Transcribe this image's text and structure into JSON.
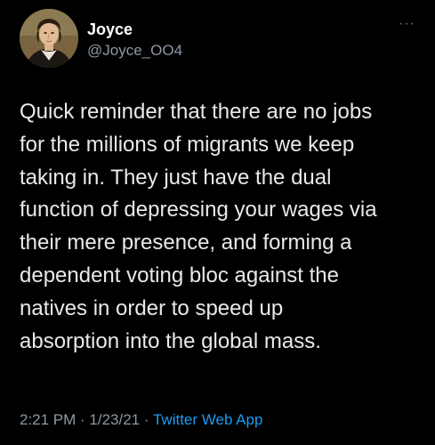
{
  "tweet": {
    "display_name": "Joyce",
    "handle": "@Joyce_OO4",
    "more_glyph": "···",
    "text": "Quick reminder that there are no jobs\nfor the millions of migrants we keep\ntaking in. They just have the dual\nfunction of depressing your wages via\ntheir mere presence, and forming a\ndependent voting bloc against the\nnatives in order to speed up\nabsorption into the global mass.",
    "time": "2:21 PM",
    "separator": " · ",
    "date": "1/23/21",
    "source": "Twitter Web App",
    "avatar_icon": "portrait-avatar"
  },
  "colors": {
    "background": "#000000",
    "text": "#e7e9ea",
    "secondary": "#8b98a5",
    "link": "#1d9bf0"
  }
}
